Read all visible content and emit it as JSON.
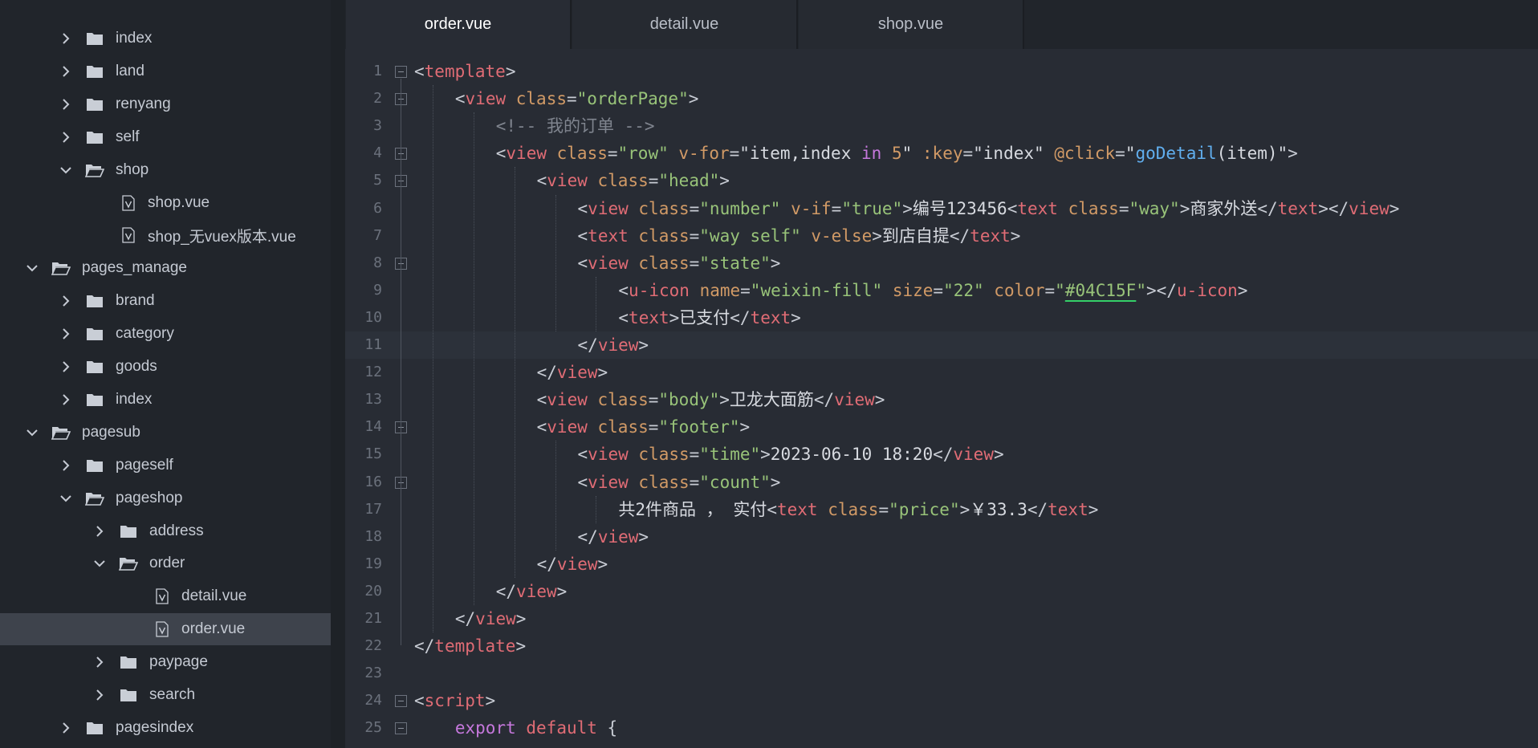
{
  "sidebar": {
    "items": [
      {
        "label": "index",
        "kind": "folder",
        "expanded": false,
        "depth": 2
      },
      {
        "label": "land",
        "kind": "folder",
        "expanded": false,
        "depth": 2
      },
      {
        "label": "renyang",
        "kind": "folder",
        "expanded": false,
        "depth": 2
      },
      {
        "label": "self",
        "kind": "folder",
        "expanded": false,
        "depth": 2
      },
      {
        "label": "shop",
        "kind": "folder",
        "expanded": true,
        "depth": 2
      },
      {
        "label": "shop.vue",
        "kind": "vue",
        "depth": 3
      },
      {
        "label": "shop_无vuex版本.vue",
        "kind": "vue",
        "depth": 3
      },
      {
        "label": "pages_manage",
        "kind": "folder",
        "expanded": true,
        "depth": 1
      },
      {
        "label": "brand",
        "kind": "folder",
        "expanded": false,
        "depth": 2
      },
      {
        "label": "category",
        "kind": "folder",
        "expanded": false,
        "depth": 2
      },
      {
        "label": "goods",
        "kind": "folder",
        "expanded": false,
        "depth": 2
      },
      {
        "label": "index",
        "kind": "folder",
        "expanded": false,
        "depth": 2
      },
      {
        "label": "pagesub",
        "kind": "folder",
        "expanded": true,
        "depth": 1
      },
      {
        "label": "pageself",
        "kind": "folder",
        "expanded": false,
        "depth": 2
      },
      {
        "label": "pageshop",
        "kind": "folder",
        "expanded": true,
        "depth": 2
      },
      {
        "label": "address",
        "kind": "folder",
        "expanded": false,
        "depth": 3
      },
      {
        "label": "order",
        "kind": "folder",
        "expanded": true,
        "depth": 3
      },
      {
        "label": "detail.vue",
        "kind": "vue",
        "depth": 4
      },
      {
        "label": "order.vue",
        "kind": "vue",
        "depth": 4,
        "selected": true
      },
      {
        "label": "paypage",
        "kind": "folder",
        "expanded": false,
        "depth": 3
      },
      {
        "label": "search",
        "kind": "folder",
        "expanded": false,
        "depth": 3
      },
      {
        "label": "pagesindex",
        "kind": "folder",
        "expanded": false,
        "depth": 2
      }
    ]
  },
  "tabs": [
    {
      "label": "order.vue",
      "active": true
    },
    {
      "label": "detail.vue",
      "active": false
    },
    {
      "label": "shop.vue",
      "active": false
    }
  ],
  "editor": {
    "lines": [
      {
        "n": "1",
        "fold": true,
        "indent": 0,
        "tokens": [
          [
            "punc",
            "<"
          ],
          [
            "tag",
            "template"
          ],
          [
            "punc",
            ">"
          ]
        ]
      },
      {
        "n": "2",
        "fold": true,
        "indent": 1,
        "tokens": [
          [
            "punc",
            "<"
          ],
          [
            "tag",
            "view"
          ],
          [
            "punc",
            " "
          ],
          [
            "attr",
            "class"
          ],
          [
            "punc",
            "="
          ],
          [
            "str",
            "\"orderPage\""
          ],
          [
            "punc",
            ">"
          ]
        ]
      },
      {
        "n": "3",
        "fold": false,
        "indent": 2,
        "tokens": [
          [
            "comment",
            "<!-- 我的订单 -->"
          ]
        ]
      },
      {
        "n": "4",
        "fold": true,
        "indent": 2,
        "tokens": [
          [
            "punc",
            "<"
          ],
          [
            "tag",
            "view"
          ],
          [
            "punc",
            " "
          ],
          [
            "attr",
            "class"
          ],
          [
            "punc",
            "="
          ],
          [
            "str",
            "\"row\""
          ],
          [
            "punc",
            " "
          ],
          [
            "attr",
            "v-for"
          ],
          [
            "punc",
            "="
          ],
          [
            "text",
            "\"item,index "
          ],
          [
            "kw",
            "in"
          ],
          [
            "text",
            " "
          ],
          [
            "num",
            "5"
          ],
          [
            "text",
            "\""
          ],
          [
            "punc",
            " "
          ],
          [
            "attr",
            ":key"
          ],
          [
            "punc",
            "="
          ],
          [
            "text",
            "\"index\""
          ],
          [
            "punc",
            " "
          ],
          [
            "attr",
            "@click"
          ],
          [
            "punc",
            "="
          ],
          [
            "text",
            "\""
          ],
          [
            "fn",
            "goDetail"
          ],
          [
            "text",
            "(item)\""
          ],
          [
            "punc",
            ">"
          ]
        ]
      },
      {
        "n": "5",
        "fold": true,
        "indent": 3,
        "tokens": [
          [
            "punc",
            "<"
          ],
          [
            "tag",
            "view"
          ],
          [
            "punc",
            " "
          ],
          [
            "attr",
            "class"
          ],
          [
            "punc",
            "="
          ],
          [
            "str",
            "\"head\""
          ],
          [
            "punc",
            ">"
          ]
        ]
      },
      {
        "n": "6",
        "fold": false,
        "indent": 4,
        "tokens": [
          [
            "punc",
            "<"
          ],
          [
            "tag",
            "view"
          ],
          [
            "punc",
            " "
          ],
          [
            "attr",
            "class"
          ],
          [
            "punc",
            "="
          ],
          [
            "str",
            "\"number\""
          ],
          [
            "punc",
            " "
          ],
          [
            "attr",
            "v-if"
          ],
          [
            "punc",
            "="
          ],
          [
            "str",
            "\"true\""
          ],
          [
            "punc",
            ">"
          ],
          [
            "text",
            "编号123456"
          ],
          [
            "punc",
            "<"
          ],
          [
            "tag",
            "text"
          ],
          [
            "punc",
            " "
          ],
          [
            "attr",
            "class"
          ],
          [
            "punc",
            "="
          ],
          [
            "str",
            "\"way\""
          ],
          [
            "punc",
            ">"
          ],
          [
            "text",
            "商家外送"
          ],
          [
            "punc",
            "</"
          ],
          [
            "tag",
            "text"
          ],
          [
            "punc",
            "></"
          ],
          [
            "tag",
            "view"
          ],
          [
            "punc",
            ">"
          ]
        ]
      },
      {
        "n": "7",
        "fold": false,
        "indent": 4,
        "tokens": [
          [
            "punc",
            "<"
          ],
          [
            "tag",
            "text"
          ],
          [
            "punc",
            " "
          ],
          [
            "attr",
            "class"
          ],
          [
            "punc",
            "="
          ],
          [
            "str",
            "\"way self\""
          ],
          [
            "punc",
            " "
          ],
          [
            "attr",
            "v-else"
          ],
          [
            "punc",
            ">"
          ],
          [
            "text",
            "到店自提"
          ],
          [
            "punc",
            "</"
          ],
          [
            "tag",
            "text"
          ],
          [
            "punc",
            ">"
          ]
        ]
      },
      {
        "n": "8",
        "fold": true,
        "indent": 4,
        "tokens": [
          [
            "punc",
            "<"
          ],
          [
            "tag",
            "view"
          ],
          [
            "punc",
            " "
          ],
          [
            "attr",
            "class"
          ],
          [
            "punc",
            "="
          ],
          [
            "str",
            "\"state\""
          ],
          [
            "punc",
            ">"
          ]
        ]
      },
      {
        "n": "9",
        "fold": false,
        "indent": 5,
        "tokens": [
          [
            "punc",
            "<"
          ],
          [
            "tag",
            "u-icon"
          ],
          [
            "punc",
            " "
          ],
          [
            "attr",
            "name"
          ],
          [
            "punc",
            "="
          ],
          [
            "str",
            "\"weixin-fill\""
          ],
          [
            "punc",
            " "
          ],
          [
            "attr",
            "size"
          ],
          [
            "punc",
            "="
          ],
          [
            "str",
            "\"22\""
          ],
          [
            "punc",
            " "
          ],
          [
            "attr",
            "color"
          ],
          [
            "punc",
            "="
          ],
          [
            "str",
            "\""
          ],
          [
            "strU",
            "#04C15F"
          ],
          [
            "str",
            "\""
          ],
          [
            "punc",
            "></"
          ],
          [
            "tag",
            "u-icon"
          ],
          [
            "punc",
            ">"
          ]
        ]
      },
      {
        "n": "10",
        "fold": false,
        "indent": 5,
        "tokens": [
          [
            "punc",
            "<"
          ],
          [
            "tag",
            "text"
          ],
          [
            "punc",
            ">"
          ],
          [
            "text",
            "已支付"
          ],
          [
            "punc",
            "</"
          ],
          [
            "tag",
            "text"
          ],
          [
            "punc",
            ">"
          ]
        ]
      },
      {
        "n": "11",
        "fold": false,
        "indent": 4,
        "current": true,
        "tokens": [
          [
            "punc",
            "</"
          ],
          [
            "tag",
            "view"
          ],
          [
            "punc",
            ">"
          ]
        ]
      },
      {
        "n": "12",
        "fold": false,
        "indent": 3,
        "tokens": [
          [
            "punc",
            "</"
          ],
          [
            "tag",
            "view"
          ],
          [
            "punc",
            ">"
          ]
        ]
      },
      {
        "n": "13",
        "fold": false,
        "indent": 3,
        "tokens": [
          [
            "punc",
            "<"
          ],
          [
            "tag",
            "view"
          ],
          [
            "punc",
            " "
          ],
          [
            "attr",
            "class"
          ],
          [
            "punc",
            "="
          ],
          [
            "str",
            "\"body\""
          ],
          [
            "punc",
            ">"
          ],
          [
            "text",
            "卫龙大面筋"
          ],
          [
            "punc",
            "</"
          ],
          [
            "tag",
            "view"
          ],
          [
            "punc",
            ">"
          ]
        ]
      },
      {
        "n": "14",
        "fold": true,
        "indent": 3,
        "tokens": [
          [
            "punc",
            "<"
          ],
          [
            "tag",
            "view"
          ],
          [
            "punc",
            " "
          ],
          [
            "attr",
            "class"
          ],
          [
            "punc",
            "="
          ],
          [
            "str",
            "\"footer\""
          ],
          [
            "punc",
            ">"
          ]
        ]
      },
      {
        "n": "15",
        "fold": false,
        "indent": 4,
        "tokens": [
          [
            "punc",
            "<"
          ],
          [
            "tag",
            "view"
          ],
          [
            "punc",
            " "
          ],
          [
            "attr",
            "class"
          ],
          [
            "punc",
            "="
          ],
          [
            "str",
            "\"time\""
          ],
          [
            "punc",
            ">"
          ],
          [
            "text",
            "2023-06-10 18:20"
          ],
          [
            "punc",
            "</"
          ],
          [
            "tag",
            "view"
          ],
          [
            "punc",
            ">"
          ]
        ]
      },
      {
        "n": "16",
        "fold": true,
        "indent": 4,
        "tokens": [
          [
            "punc",
            "<"
          ],
          [
            "tag",
            "view"
          ],
          [
            "punc",
            " "
          ],
          [
            "attr",
            "class"
          ],
          [
            "punc",
            "="
          ],
          [
            "str",
            "\"count\""
          ],
          [
            "punc",
            ">"
          ]
        ]
      },
      {
        "n": "17",
        "fold": false,
        "indent": 5,
        "tokens": [
          [
            "text",
            "共2件商品 ， 实付"
          ],
          [
            "punc",
            "<"
          ],
          [
            "tag",
            "text"
          ],
          [
            "punc",
            " "
          ],
          [
            "attr",
            "class"
          ],
          [
            "punc",
            "="
          ],
          [
            "str",
            "\"price\""
          ],
          [
            "punc",
            ">"
          ],
          [
            "text",
            "￥33.3"
          ],
          [
            "punc",
            "</"
          ],
          [
            "tag",
            "text"
          ],
          [
            "punc",
            ">"
          ]
        ]
      },
      {
        "n": "18",
        "fold": false,
        "indent": 4,
        "tokens": [
          [
            "punc",
            "</"
          ],
          [
            "tag",
            "view"
          ],
          [
            "punc",
            ">"
          ]
        ]
      },
      {
        "n": "19",
        "fold": false,
        "indent": 3,
        "tokens": [
          [
            "punc",
            "</"
          ],
          [
            "tag",
            "view"
          ],
          [
            "punc",
            ">"
          ]
        ]
      },
      {
        "n": "20",
        "fold": false,
        "indent": 2,
        "tokens": [
          [
            "punc",
            "</"
          ],
          [
            "tag",
            "view"
          ],
          [
            "punc",
            ">"
          ]
        ]
      },
      {
        "n": "21",
        "fold": false,
        "indent": 1,
        "tokens": [
          [
            "punc",
            "</"
          ],
          [
            "tag",
            "view"
          ],
          [
            "punc",
            ">"
          ]
        ]
      },
      {
        "n": "22",
        "fold": false,
        "indent": 0,
        "tokens": [
          [
            "punc",
            "</"
          ],
          [
            "tag",
            "template"
          ],
          [
            "punc",
            ">"
          ]
        ]
      },
      {
        "n": "23",
        "fold": false,
        "indent": 0,
        "tokens": []
      },
      {
        "n": "24",
        "fold": true,
        "indent": 0,
        "tokens": [
          [
            "punc",
            "<"
          ],
          [
            "tag",
            "script"
          ],
          [
            "punc",
            ">"
          ]
        ]
      },
      {
        "n": "25",
        "fold": true,
        "indent": 1,
        "tokens": [
          [
            "kw",
            "export"
          ],
          [
            "punc",
            " "
          ],
          [
            "tag",
            "default"
          ],
          [
            "punc",
            " {"
          ]
        ]
      }
    ]
  },
  "colors": {
    "sidebar_bg": "#21252b",
    "editor_bg": "#282c34",
    "selected_row": "#3e434c",
    "tag": "#e06c75",
    "attr": "#d19a66",
    "string": "#98c379",
    "keyword": "#c678dd",
    "function": "#61afef",
    "underline": "#35d068"
  },
  "icons": {
    "folder": "folder-icon",
    "folder_open": "folder-open-icon",
    "vue_file": "vue-file-icon",
    "chevron_right": "chevron-right-icon",
    "chevron_down": "chevron-down-icon",
    "fold_toggle": "fold-toggle-icon"
  }
}
